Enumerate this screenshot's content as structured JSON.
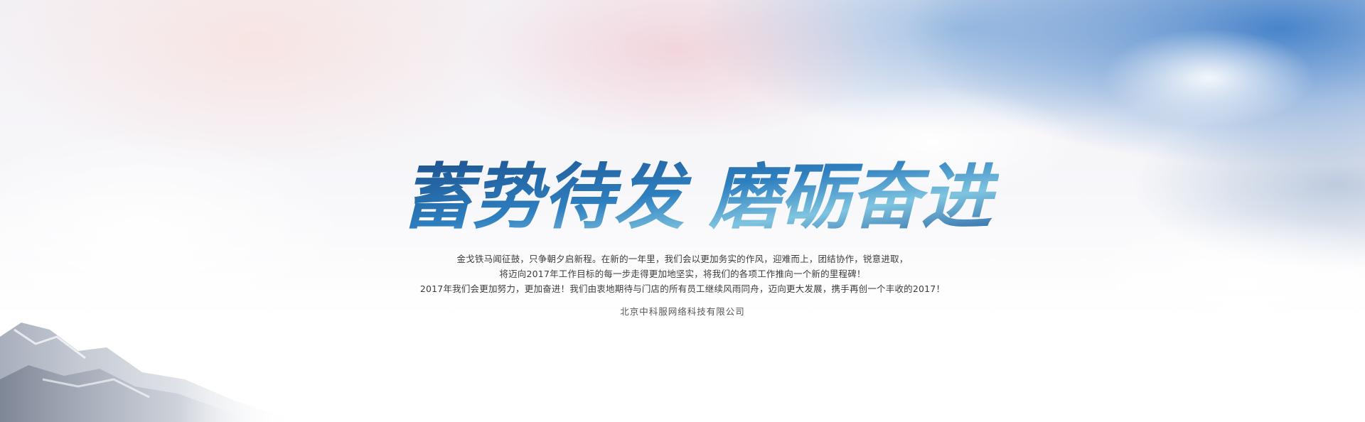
{
  "banner": {
    "headline": "蓄势待发 磨砺奋进",
    "description_lines": [
      "金戈铁马闻征鼓，只争朝夕启新程。在新的一年里，我们会以更加务实的作风，迎难而上，团结协作，锐意进取，",
      "将迈向2017年工作目标的每一步走得更加地坚实，将我们的各项工作推向一个新的里程碑！",
      "2017年我们会更加努力，更加奋进！我们由衷地期待与门店的所有员工继续风雨同舟，迈向更大发展，携手再创一个丰收的2017！"
    ],
    "company": "北京中科服网络科技有限公司",
    "colors": {
      "headline_dark": "#1c4f8c",
      "headline_mid": "#2e7fbf",
      "headline_light": "#7fc4e0",
      "sky_blue": "#3f7ec8",
      "text": "#3c3c3c"
    }
  }
}
